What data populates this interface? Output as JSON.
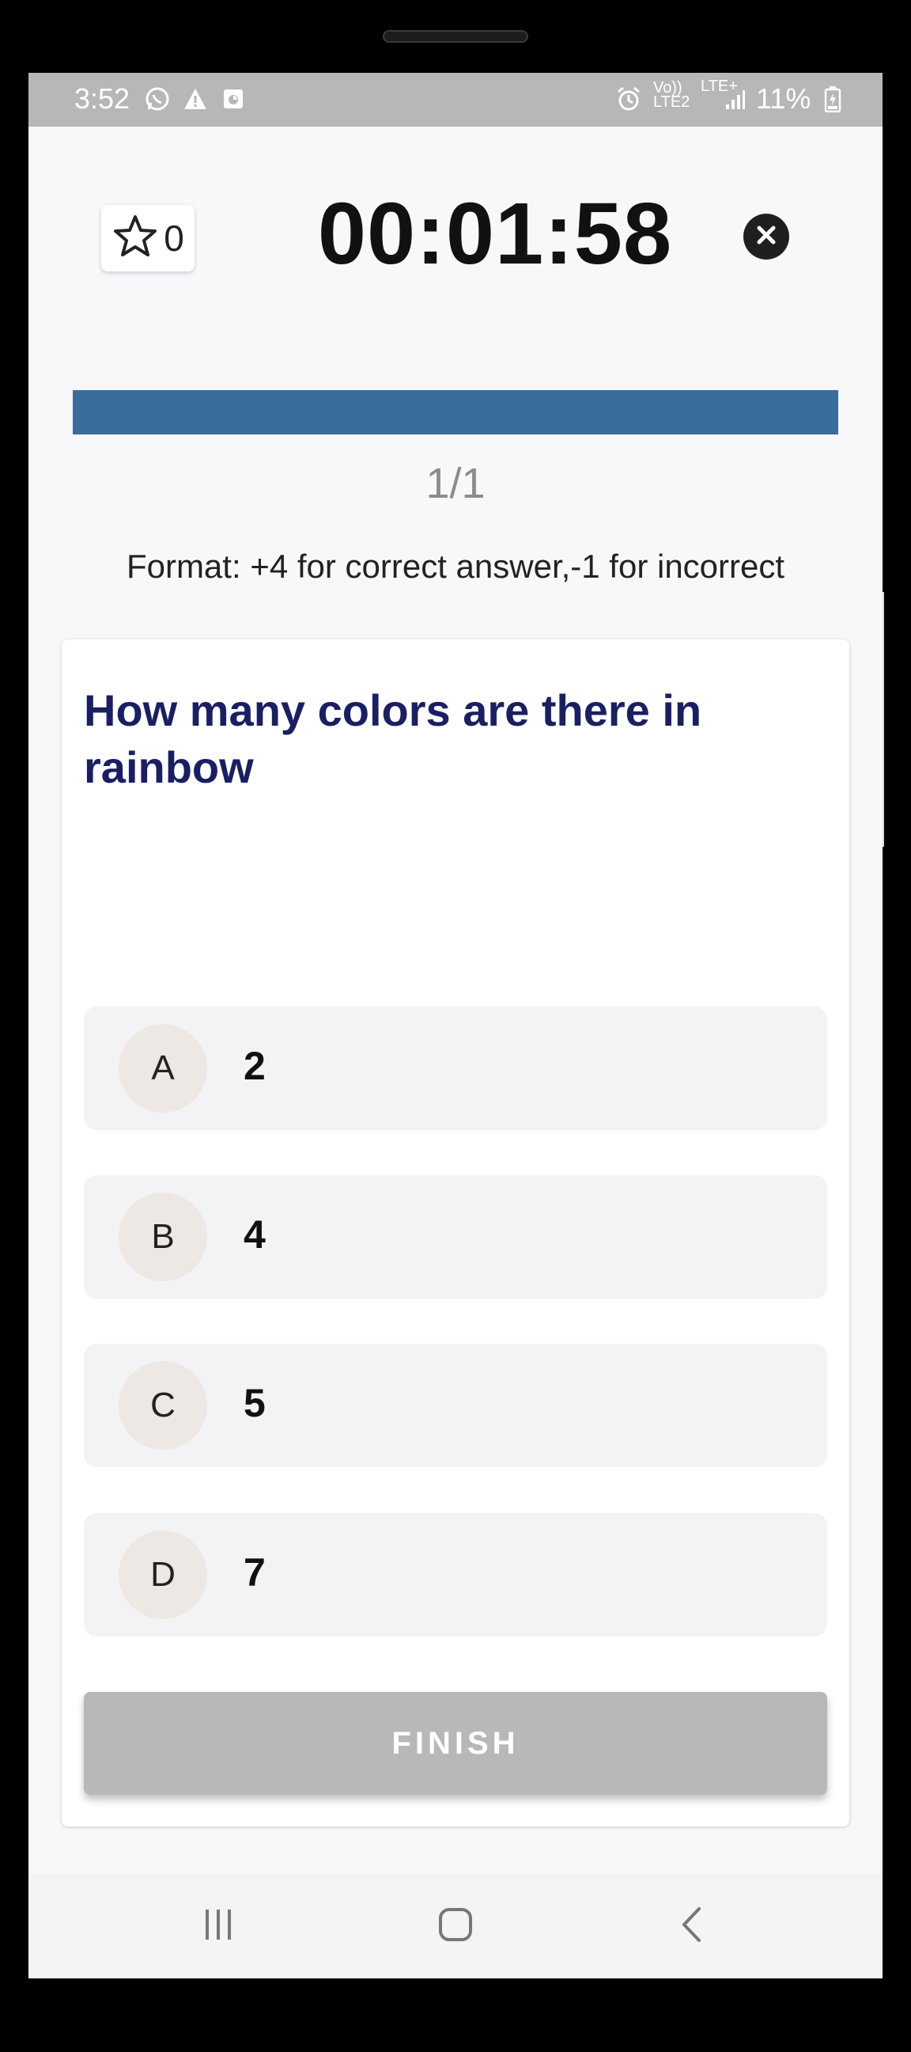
{
  "status_bar": {
    "time": "3:52",
    "network_top": "Vo))",
    "network_bottom": "LTE2",
    "lte_label": "LTE+",
    "battery": "11%",
    "icons": [
      "whatsapp-icon",
      "warning-icon",
      "sim-icon",
      "alarm-icon",
      "signal-icon",
      "battery-icon"
    ]
  },
  "header": {
    "bookmark_count": "0",
    "timer": "00:01:58"
  },
  "progress": {
    "fraction": 1.0,
    "counter": "1/1",
    "color": "#386c9b"
  },
  "format_text": "Format: +4 for correct answer,-1 for incorrect",
  "question": {
    "text": "How many colors are there in rainbow",
    "color": "#1a1f64"
  },
  "options": [
    {
      "letter": "A",
      "text": "2"
    },
    {
      "letter": "B",
      "text": "4"
    },
    {
      "letter": "C",
      "text": "5"
    },
    {
      "letter": "D",
      "text": "7"
    }
  ],
  "finish_label": "FINISH",
  "nav": {
    "icons": [
      "recent-apps-icon",
      "home-icon",
      "back-icon"
    ]
  }
}
